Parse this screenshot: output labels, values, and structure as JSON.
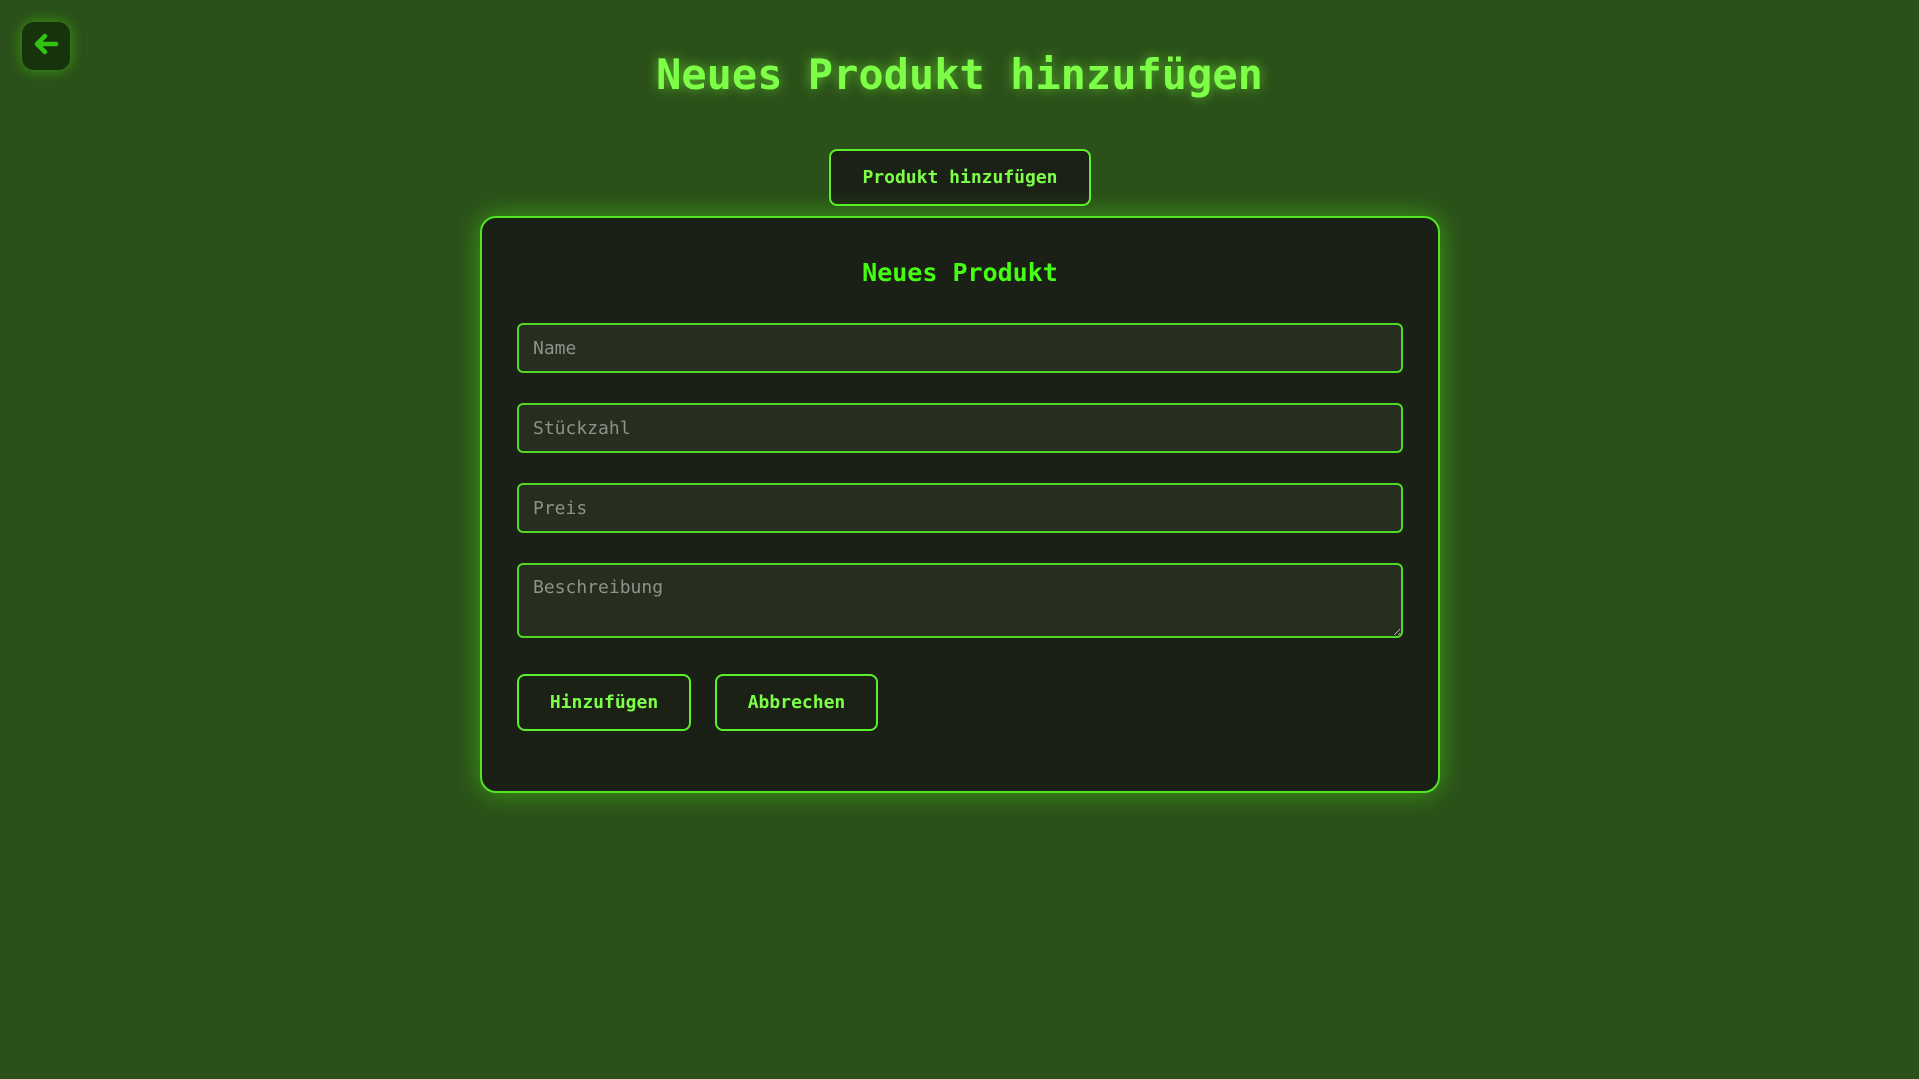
{
  "nav": {
    "back_icon": "arrow-left-icon"
  },
  "page": {
    "title": "Neues Produkt hinzufügen"
  },
  "toolbar": {
    "toggle_label": "Produkt hinzufügen"
  },
  "form": {
    "heading": "Neues Produkt",
    "name_placeholder": "Name",
    "name_value": "",
    "quantity_placeholder": "Stückzahl",
    "quantity_value": "",
    "price_placeholder": "Preis",
    "price_value": "",
    "description_placeholder": "Beschreibung",
    "description_value": "",
    "submit_label": "Hinzufügen",
    "cancel_label": "Abbrechen"
  },
  "colors": {
    "background": "#2b5019",
    "accent": "#5af02a",
    "title_text": "#7dff48",
    "card_background": "#1b2016"
  }
}
